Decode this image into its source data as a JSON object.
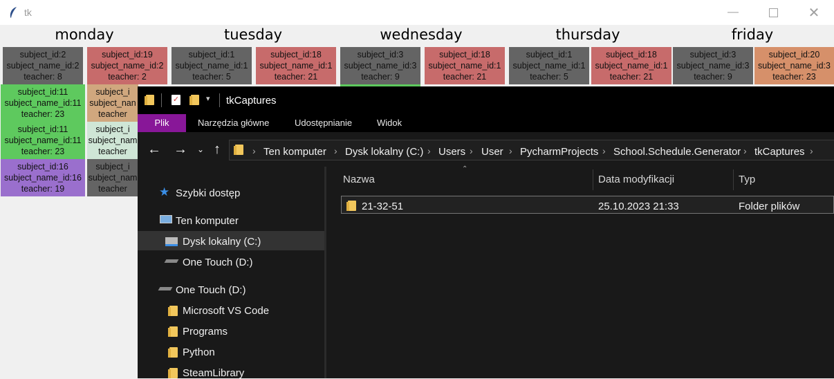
{
  "tk_window": {
    "title": "tk",
    "days": [
      "monday",
      "tuesday",
      "wednesday",
      "thursday",
      "friday"
    ],
    "cells": [
      {
        "text": [
          "subject_id:2",
          "subject_name_id:2",
          "teacher: 8"
        ],
        "color": "gray"
      },
      {
        "text": [
          "subject_id:19",
          "subject_name_id:2",
          "teacher: 2"
        ],
        "color": "red"
      },
      {
        "text": [
          "subject_id:1",
          "subject_name_id:1",
          "teacher: 5"
        ],
        "color": "gray"
      },
      {
        "text": [
          "subject_id:18",
          "subject_name_id:1",
          "teacher: 21"
        ],
        "color": "red"
      },
      {
        "text": [
          "subject_id:3",
          "subject_name_id:3",
          "teacher: 9"
        ],
        "color": "gray"
      },
      {
        "text": [
          "subject_id:18",
          "subject_name_id:1",
          "teacher: 21"
        ],
        "color": "red"
      },
      {
        "text": [
          "subject_id:1",
          "subject_name_id:1",
          "teacher: 5"
        ],
        "color": "gray"
      },
      {
        "text": [
          "subject_id:18",
          "subject_name_id:1",
          "teacher: 21"
        ],
        "color": "red"
      },
      {
        "text": [
          "subject_id:3",
          "subject_name_id:3",
          "teacher: 9"
        ],
        "color": "gray"
      },
      {
        "text": [
          "subject_id:20",
          "subject_name_id:3",
          "teacher: 23"
        ],
        "color": "orange"
      },
      {
        "text": [
          "subject_id:11",
          "subject_name_id:11",
          "teacher: 23"
        ],
        "color": "green"
      },
      {
        "text": [
          "subject_i",
          "subject_nan",
          "teacher"
        ],
        "color": "tan"
      },
      {
        "text": [
          "subject_id:11",
          "subject_name_id:11",
          "teacher: 23"
        ],
        "color": "green"
      },
      {
        "text": [
          "subject_i",
          "subject_nam",
          "teacher"
        ],
        "color": "mint"
      },
      {
        "text": [
          "subject_id:16",
          "subject_name_id:16",
          "teacher: 19"
        ],
        "color": "purple"
      },
      {
        "text": [
          "subject_i",
          "subject_nam",
          "teacher"
        ],
        "color": "gray"
      }
    ]
  },
  "explorer": {
    "title": "tkCaptures",
    "ribbon_tabs": [
      "Plik",
      "Narzędzia główne",
      "Udostępnianie",
      "Widok"
    ],
    "breadcrumb": [
      "Ten komputer",
      "Dysk lokalny (C:)",
      "Users",
      "User",
      "PycharmProjects",
      "School.Schedule.Generator",
      "tkCaptures"
    ],
    "nav_items": [
      "Szybki dostęp",
      "Ten komputer",
      "Dysk lokalny (C:)",
      "One Touch (D:)",
      "One Touch (D:)",
      "Microsoft VS Code",
      "Programs",
      "Python",
      "SteamLibrary"
    ],
    "columns": [
      "Nazwa",
      "Data modyfikacji",
      "Typ"
    ],
    "files": [
      {
        "name": "21-32-51",
        "date": "25.10.2023 21:33",
        "type": "Folder plików"
      }
    ]
  },
  "colors": {
    "accent": "#881798",
    "gray": "#646464",
    "red": "#c76b6b",
    "green": "#5ec95e"
  }
}
